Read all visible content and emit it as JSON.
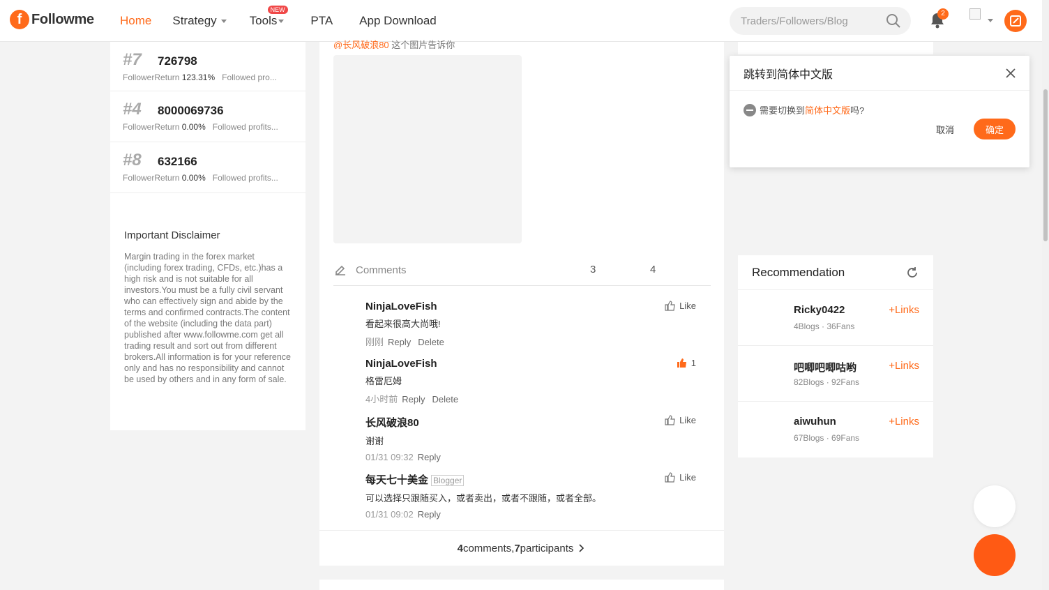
{
  "brand": {
    "name": "Followme"
  },
  "nav": {
    "home": "Home",
    "strategy": "Strategy",
    "tools": "Tools",
    "tools_badge": "NEW",
    "pta": "PTA",
    "app_download": "App Download"
  },
  "search": {
    "placeholder": "Traders/Followers/Blog"
  },
  "notifications": {
    "count": "2"
  },
  "colors": {
    "accent": "#ff6a1a"
  },
  "ranking": [
    {
      "rank": "#7",
      "id": "726798",
      "label": "Follower",
      "return_label": "Return",
      "return_value": "123.31%",
      "note": "Followed pro..."
    },
    {
      "rank": "#4",
      "id": "8000069736",
      "label": "Follower",
      "return_label": "Return",
      "return_value": "0.00%",
      "note": "Followed profits..."
    },
    {
      "rank": "#8",
      "id": "632166",
      "label": "Follower",
      "return_label": "Return",
      "return_value": "0.00%",
      "note": "Followed profits..."
    }
  ],
  "disclaimer": {
    "title": "Important Disclaimer",
    "text": "Margin trading in the forex market (including forex trading, CFDs, etc.)has a high risk and is not suitable for all investors.You must be a fully civil servant who can effectively sign and abide by the terms and confirmed contracts.The content of the website (including the data part) published after www.followme.com get all trading result and sort out from different brokers.All information is for your reference only and has no responsibility and cannot be used by others and in any form of sale."
  },
  "post": {
    "mention": "@长风破浪80",
    "mention_text": " 这个图片告诉你"
  },
  "comments_bar": {
    "label": "Comments",
    "count_a": "3",
    "count_b": "4"
  },
  "comments": [
    {
      "user": "NinjaLoveFish",
      "text": "看起来很高大尚哦!",
      "time": "刚刚",
      "reply": "Reply",
      "delete": "Delete",
      "like": "Like"
    },
    {
      "user": "NinjaLoveFish",
      "text": "格雷厄姆",
      "time": "4小时前",
      "reply": "Reply",
      "delete": "Delete",
      "like": "1"
    },
    {
      "user": "长风破浪80",
      "text": "谢谢",
      "time": "01/31 09:32",
      "reply": "Reply",
      "like": "Like"
    },
    {
      "user": "每天七十美金",
      "tag": "Blogger",
      "text": "可以选择只跟随买入，或者卖出，或者不跟随，或者全部。",
      "time": "01/31 09:02",
      "reply": "Reply",
      "like": "Like"
    }
  ],
  "summary": {
    "comments_n": "4",
    "comments_word": " comments, ",
    "participants_n": "7",
    "participants_word": " participants"
  },
  "lang_popup": {
    "title": "跳转到简体中文版",
    "text_pre": "需要切换到",
    "text_hl": "简体中文版",
    "text_post": "吗?",
    "cancel": "取消",
    "confirm": "确定"
  },
  "recommendation": {
    "title": "Recommendation",
    "items": [
      {
        "name": "Ricky0422",
        "stats": "4Blogs · 36Fans",
        "action": "Links"
      },
      {
        "name": "吧唧吧唧咕哟",
        "stats": "82Blogs · 92Fans",
        "action": "Links"
      },
      {
        "name": "aiwuhun",
        "stats": "67Blogs · 69Fans",
        "action": "Links"
      }
    ]
  }
}
